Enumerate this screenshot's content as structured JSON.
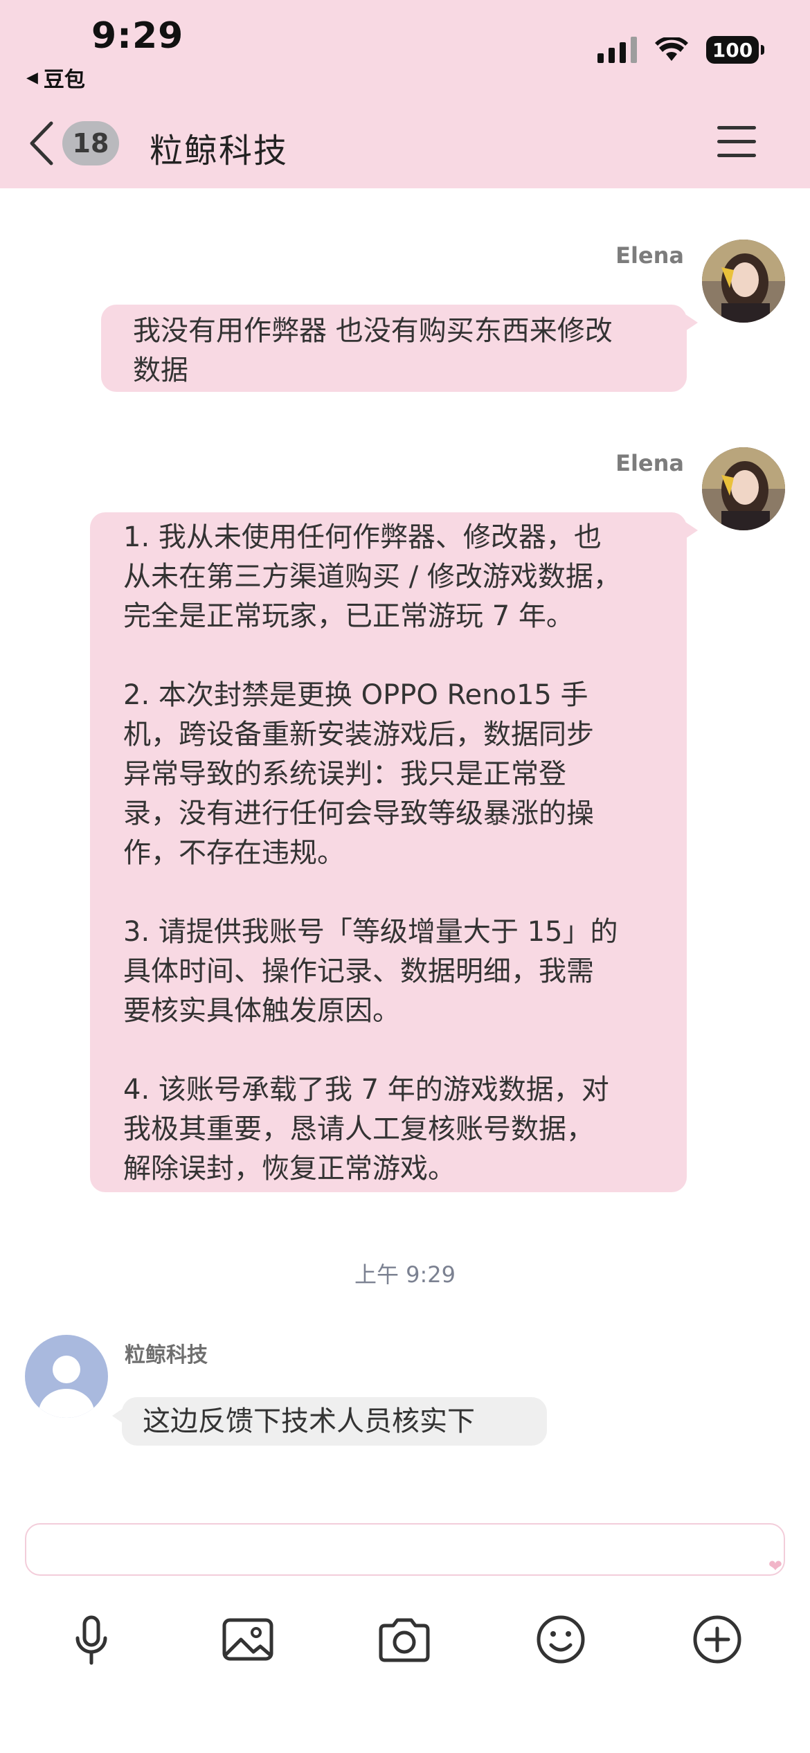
{
  "status_bar": {
    "time": "9:29",
    "back_app": "豆包",
    "battery": "100"
  },
  "nav": {
    "unread_count": "18",
    "title": "粒鲸科技"
  },
  "messages": [
    {
      "sender": "Elena",
      "text": "我没有用作弊器 也没有购买东西来修改\n数据"
    },
    {
      "sender": "Elena",
      "text": "1. 我从未使用任何作弊器、修改器，也\n从未在第三方渠道购买 / 修改游戏数据，\n完全是正常玩家，已正常游玩 7 年。\n\n2. 本次封禁是更换 OPPO Reno15 手\n机，跨设备重新安装游戏后，数据同步\n异常导致的系统误判：我只是正常登\n录，没有进行任何会导致等级暴涨的操\n作，不存在违规。\n\n3. 请提供我账号「等级增量大于 15」的\n具体时间、操作记录、数据明细，我需\n要核实具体触发原因。\n\n4. 该账号承载了我 7 年的游戏数据，对\n我极其重要，恳请人工复核账号数据，\n解除误封，恢复正常游戏。"
    }
  ],
  "timestamp": "上午 9:29",
  "reply": {
    "sender": "粒鲸科技",
    "text": "这边反馈下技术人员核实下"
  },
  "input": {
    "value": "",
    "placeholder": ""
  },
  "colors": {
    "header_bg": "#f8d9e3",
    "outgoing_bubble": "#f8d9e3",
    "incoming_bubble": "#efefef",
    "default_avatar": "#a9b9de"
  },
  "toolbar": [
    "microphone-icon",
    "image-icon",
    "camera-icon",
    "emoji-icon",
    "plus-icon"
  ]
}
